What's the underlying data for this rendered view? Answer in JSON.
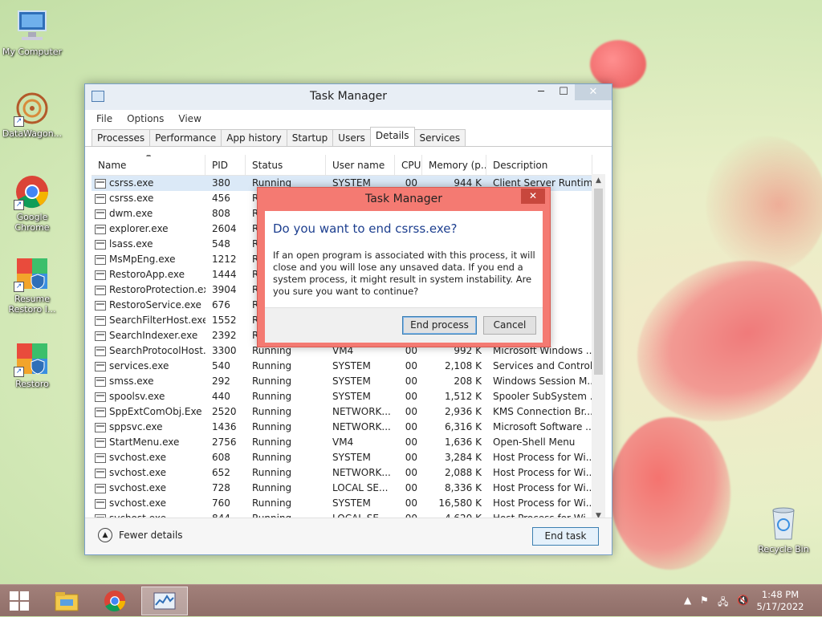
{
  "desktop": {
    "icons": [
      {
        "label": "My Computer"
      },
      {
        "label": "DataWagon..."
      },
      {
        "label": "Google Chrome"
      },
      {
        "label": "Resume Restoro I..."
      },
      {
        "label": "Restoro"
      },
      {
        "label": "Recycle Bin"
      }
    ]
  },
  "task_manager": {
    "title": "Task Manager",
    "menu": [
      "File",
      "Options",
      "View"
    ],
    "tabs": [
      "Processes",
      "Performance",
      "App history",
      "Startup",
      "Users",
      "Details",
      "Services"
    ],
    "active_tab": "Details",
    "columns": [
      "Name",
      "PID",
      "Status",
      "User name",
      "CPU",
      "Memory (p...",
      "Description"
    ],
    "rows": [
      [
        "csrss.exe",
        "380",
        "Running",
        "SYSTEM",
        "00",
        "944 K",
        "Client Server Runtim..."
      ],
      [
        "csrss.exe",
        "456",
        "R",
        "",
        "",
        "",
        "Runtim..."
      ],
      [
        "dwm.exe",
        "808",
        "R",
        "",
        "",
        "",
        "ow M..."
      ],
      [
        "explorer.exe",
        "2604",
        "R",
        "",
        "",
        "",
        "orer"
      ],
      [
        "lsass.exe",
        "548",
        "R",
        "",
        "",
        "",
        "Auth..."
      ],
      [
        "MsMpEng.exe",
        "1212",
        "R",
        "",
        "",
        "",
        "Service..."
      ],
      [
        "RestoroApp.exe",
        "1444",
        "R",
        "",
        "",
        "",
        "cation"
      ],
      [
        "RestoroProtection.exe",
        "3904",
        "R",
        "",
        "",
        "",
        "ction"
      ],
      [
        "RestoroService.exe",
        "676",
        "R",
        "",
        "",
        "",
        "e"
      ],
      [
        "SearchFilterHost.exe",
        "1552",
        "R",
        "",
        "",
        "",
        "ndows ..."
      ],
      [
        "SearchIndexer.exe",
        "2392",
        "R",
        "",
        "",
        "",
        "ndows ..."
      ],
      [
        "SearchProtocolHost....",
        "3300",
        "Running",
        "VM4",
        "00",
        "992 K",
        "Microsoft Windows ..."
      ],
      [
        "services.exe",
        "540",
        "Running",
        "SYSTEM",
        "00",
        "2,108 K",
        "Services and Control..."
      ],
      [
        "smss.exe",
        "292",
        "Running",
        "SYSTEM",
        "00",
        "208 K",
        "Windows Session M..."
      ],
      [
        "spoolsv.exe",
        "440",
        "Running",
        "SYSTEM",
        "00",
        "1,512 K",
        "Spooler SubSystem ..."
      ],
      [
        "SppExtComObj.Exe",
        "2520",
        "Running",
        "NETWORK...",
        "00",
        "2,936 K",
        "KMS Connection Br..."
      ],
      [
        "sppsvc.exe",
        "1436",
        "Running",
        "NETWORK...",
        "00",
        "6,316 K",
        "Microsoft Software ..."
      ],
      [
        "StartMenu.exe",
        "2756",
        "Running",
        "VM4",
        "00",
        "1,636 K",
        "Open-Shell Menu"
      ],
      [
        "svchost.exe",
        "608",
        "Running",
        "SYSTEM",
        "00",
        "3,284 K",
        "Host Process for Wi..."
      ],
      [
        "svchost.exe",
        "652",
        "Running",
        "NETWORK...",
        "00",
        "2,088 K",
        "Host Process for Wi..."
      ],
      [
        "svchost.exe",
        "728",
        "Running",
        "LOCAL SE...",
        "00",
        "8,336 K",
        "Host Process for Wi..."
      ],
      [
        "svchost.exe",
        "760",
        "Running",
        "SYSTEM",
        "00",
        "16,580 K",
        "Host Process for Wi..."
      ],
      [
        "svchost.exe",
        "844",
        "Running",
        "LOCAL SE...",
        "00",
        "4,620 K",
        "Host Process for Wi..."
      ]
    ],
    "footer": {
      "fewer_details": "Fewer details",
      "end_task": "End task"
    }
  },
  "dialog": {
    "title": "Task Manager",
    "question": "Do you want to end csrss.exe?",
    "message": "If an open program is associated with this process, it will close and you will lose any unsaved data. If you end a system process, it might result in system instability. Are you sure you want to continue?",
    "end_process": "End process",
    "cancel": "Cancel",
    "accent_color": "#f47a72"
  },
  "taskbar": {
    "time": "1:48 PM",
    "date": "5/17/2022"
  }
}
